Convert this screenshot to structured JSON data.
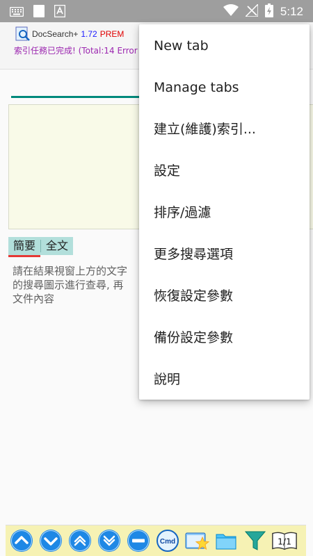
{
  "status_bar": {
    "time": "5:12",
    "icons": [
      "keyboard-icon",
      "sim-card-icon",
      "text-icon",
      "wifi-icon",
      "no-signal-icon",
      "battery-charging-icon"
    ]
  },
  "app": {
    "name": "DocSearch+",
    "version": "1.72",
    "edition": "PREM",
    "index_status": "索引任務已完成!  (Total:14 Error"
  },
  "tabs": [
    {
      "label": "簡要",
      "active": true
    },
    {
      "label": "全文",
      "active": false
    }
  ],
  "help_text": "請在結果視窗上方的文字\n的搜尋圖示進行查尋, 再\n文件內容",
  "menu": {
    "items": [
      {
        "label": "New tab"
      },
      {
        "label": "Manage tabs"
      },
      {
        "label": "建立(維護)索引..."
      },
      {
        "label": "設定"
      },
      {
        "label": "排序/過濾"
      },
      {
        "label": "更多搜尋選項"
      },
      {
        "label": "恢復設定參數"
      },
      {
        "label": "備份設定參數"
      },
      {
        "label": "說明"
      }
    ]
  },
  "toolbar": {
    "buttons": [
      {
        "icon": "double-chevron-up-icon"
      },
      {
        "icon": "double-chevron-down-icon"
      },
      {
        "icon": "chevron-up-icon"
      },
      {
        "icon": "chevron-down-icon"
      },
      {
        "icon": "minus-icon"
      },
      {
        "icon": "cmd-icon",
        "label": "Cmd"
      },
      {
        "icon": "favorites-icon"
      },
      {
        "icon": "folder-icon"
      },
      {
        "icon": "filter-icon"
      },
      {
        "icon": "page-indicator-icon",
        "label": "1/1"
      }
    ]
  },
  "colors": {
    "status_bar": "#9e9e9e",
    "accent_teal": "#00897b",
    "version_blue": "#1a1aff",
    "prem_red": "#e00000",
    "status_purple": "#9c27b0",
    "tab_bg": "#b2dfdb",
    "tab_underline": "#e53935",
    "result_bg": "#f9fae8",
    "toolbar_bg": "#f6f2b4",
    "nav_button_blue": "#1e88e5"
  }
}
